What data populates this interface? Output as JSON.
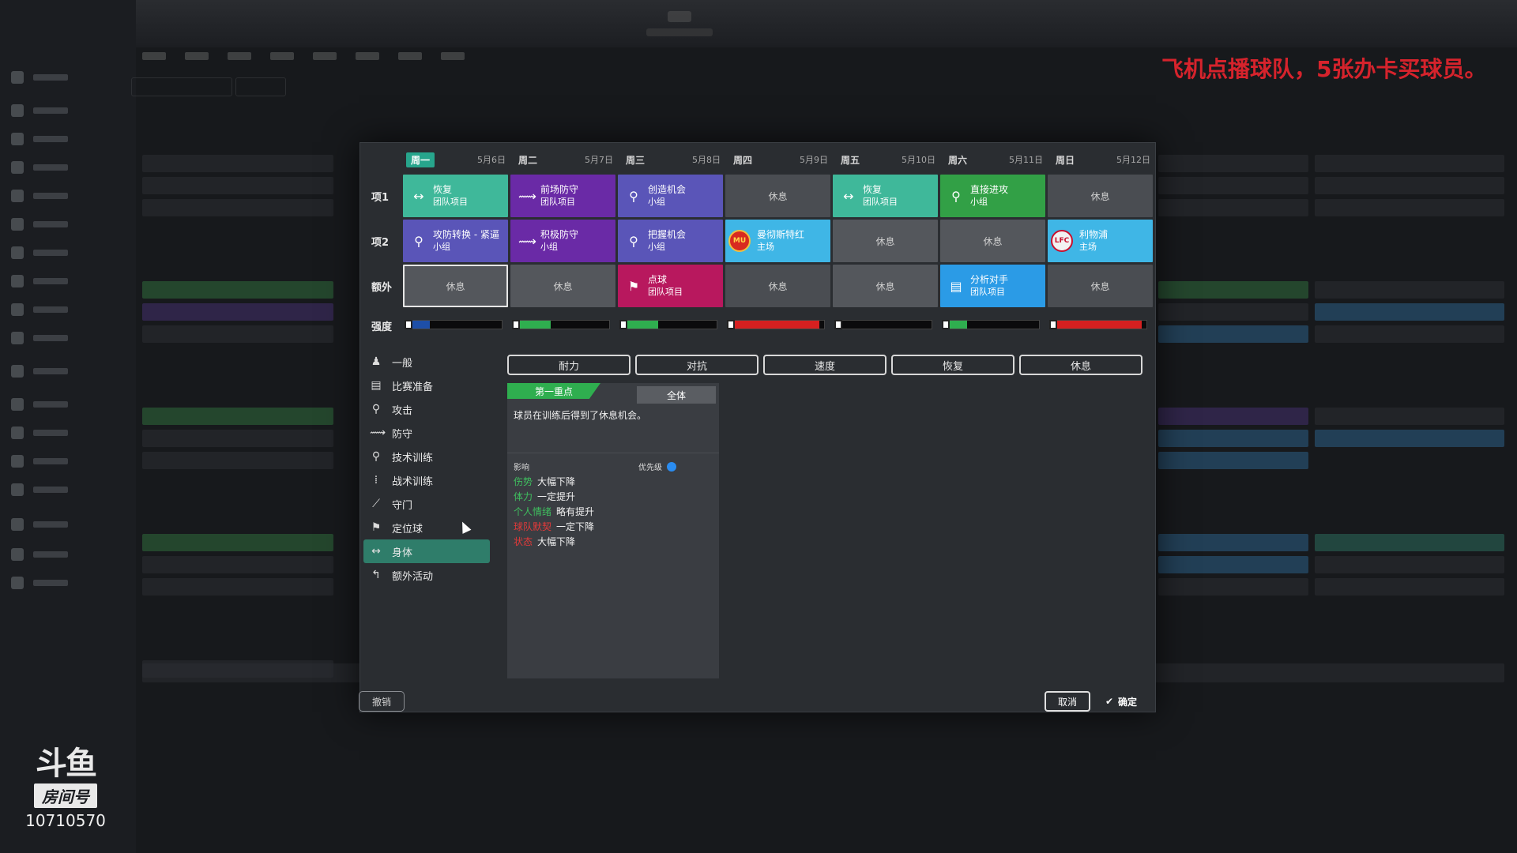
{
  "overlay": {
    "promo": "飞机点播球队，5张办卡买球员。",
    "room_label": "房间号",
    "room_number": "10710570",
    "logo_text": "斗鱼"
  },
  "schedule": {
    "days": [
      {
        "name": "周一",
        "date": "5月6日",
        "active": true
      },
      {
        "name": "周二",
        "date": "5月7日"
      },
      {
        "name": "周三",
        "date": "5月8日"
      },
      {
        "name": "周四",
        "date": "5月9日"
      },
      {
        "name": "周五",
        "date": "5月10日"
      },
      {
        "name": "周六",
        "date": "5月11日"
      },
      {
        "name": "周日",
        "date": "5月12日"
      }
    ],
    "row_labels": [
      "项1",
      "项2",
      "额外",
      "强度"
    ],
    "row1": [
      {
        "title": "恢复",
        "sub": "团队项目",
        "color": "#3fb89a",
        "icon": "recovery-icon"
      },
      {
        "title": "前场防守",
        "sub": "团队项目",
        "color": "#6a2aa6",
        "icon": "defend-icon"
      },
      {
        "title": "创造机会",
        "sub": "小组",
        "color": "#5a55b8",
        "icon": "attack-icon"
      },
      {
        "title": "休息"
      },
      {
        "title": "恢复",
        "sub": "团队项目",
        "color": "#3fb89a",
        "icon": "recovery-icon"
      },
      {
        "title": "直接进攻",
        "sub": "小组",
        "color": "#32a046",
        "icon": "attack-icon"
      },
      {
        "title": "休息"
      }
    ],
    "row2": [
      {
        "title": "攻防转换 - 紧逼",
        "sub": "小组",
        "color": "#5a55b8",
        "icon": "transition-icon"
      },
      {
        "title": "积极防守",
        "sub": "小组",
        "color": "#6a2aa6",
        "icon": "defend-icon"
      },
      {
        "title": "把握机会",
        "sub": "小组",
        "color": "#5a55b8",
        "icon": "attack-icon"
      },
      {
        "title": "曼彻斯特红",
        "sub": "主场",
        "color": "#3fb6e6",
        "icon": "manchester-red-crest"
      },
      {
        "title": "休息"
      },
      {
        "title": "休息"
      },
      {
        "title": "利物浦",
        "sub": "主场",
        "color": "#3fb6e6",
        "icon": "liverpool-crest"
      }
    ],
    "extra": [
      {
        "title": "休息",
        "selected": true
      },
      {
        "title": "休息"
      },
      {
        "title": "点球",
        "sub": "团队项目",
        "color": "#b8185e",
        "icon": "set-piece-icon"
      },
      {
        "title": "休息"
      },
      {
        "title": "休息"
      },
      {
        "title": "分析对手",
        "sub": "团队项目",
        "color": "#2b9be6",
        "icon": "analysis-icon"
      },
      {
        "title": "休息"
      }
    ],
    "intensity": [
      {
        "level": 0.2,
        "color": "#1e4fa8"
      },
      {
        "level": 0.35,
        "color": "#2fae4f"
      },
      {
        "level": 0.35,
        "color": "#2fae4f"
      },
      {
        "level": 0.95,
        "color": "#d62020"
      },
      {
        "level": 0.0,
        "color": "#2fae4f"
      },
      {
        "level": 0.2,
        "color": "#2fae4f"
      },
      {
        "level": 0.95,
        "color": "#d62020"
      }
    ]
  },
  "categories": [
    {
      "label": "一般",
      "icon": "person-icon"
    },
    {
      "label": "比赛准备",
      "icon": "clipboard-icon"
    },
    {
      "label": "攻击",
      "icon": "attack-icon"
    },
    {
      "label": "防守",
      "icon": "defend-icon"
    },
    {
      "label": "技术训练",
      "icon": "technique-icon"
    },
    {
      "label": "战术训练",
      "icon": "tactics-icon"
    },
    {
      "label": "守门",
      "icon": "goalkeeper-icon"
    },
    {
      "label": "定位球",
      "icon": "set-piece-icon"
    },
    {
      "label": "身体",
      "icon": "physical-icon",
      "selected": true
    },
    {
      "label": "额外活动",
      "icon": "extra-icon"
    }
  ],
  "focus_buttons": [
    "耐力",
    "对抗",
    "速度",
    "恢复",
    "休息"
  ],
  "detail": {
    "tab_primary": "第一重点",
    "tab_secondary": "全体",
    "description": "球员在训练后得到了休息机会。",
    "effects_label": "影响",
    "priority_label": "优先级",
    "effects": [
      {
        "name": "伤势",
        "value": "大幅下降",
        "tone": "good"
      },
      {
        "name": "体力",
        "value": "一定提升",
        "tone": "good"
      },
      {
        "name": "个人情绪",
        "value": "略有提升",
        "tone": "good"
      },
      {
        "name": "球队默契",
        "value": "一定下降",
        "tone": "bad"
      },
      {
        "name": "状态",
        "value": "大幅下降",
        "tone": "bad"
      }
    ]
  },
  "buttons": {
    "undo": "撤销",
    "cancel": "取消",
    "ok": "确定"
  }
}
